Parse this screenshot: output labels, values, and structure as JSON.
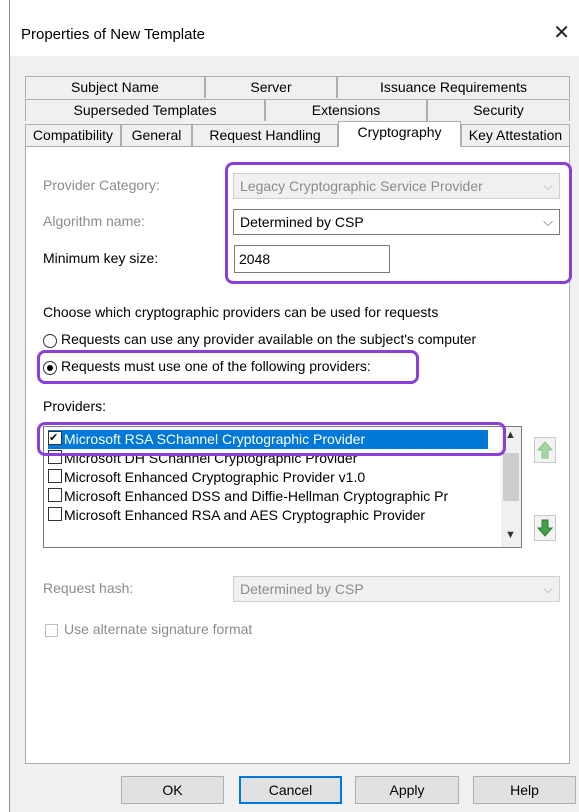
{
  "window": {
    "title": "Properties of New Template",
    "close_glyph": "✕"
  },
  "tabs": {
    "row1": [
      "Subject Name",
      "Server",
      "Issuance Requirements"
    ],
    "row2": [
      "Superseded Templates",
      "Extensions",
      "Security"
    ],
    "row3": [
      "Compatibility",
      "General",
      "Request Handling",
      "Cryptography",
      "Key Attestation"
    ],
    "active": "Cryptography"
  },
  "form": {
    "provider_category_label": "Provider Category:",
    "provider_category_value": "Legacy Cryptographic Service Provider",
    "algorithm_label": "Algorithm name:",
    "algorithm_value": "Determined by CSP",
    "min_key_label": "Minimum key size:",
    "min_key_value": "2048",
    "choose_text": "Choose which cryptographic providers can be used for requests",
    "radio_any": "Requests can use any provider available on the subject's computer",
    "radio_must": "Requests must use one of the following providers:",
    "radio_selected": "must",
    "providers_label": "Providers:",
    "providers": [
      {
        "label": "Microsoft RSA SChannel Cryptographic Provider",
        "checked": true,
        "selected": true
      },
      {
        "label": "Microsoft DH SChannel Cryptographic Provider",
        "checked": false,
        "selected": false
      },
      {
        "label": "Microsoft Enhanced Cryptographic Provider v1.0",
        "checked": false,
        "selected": false
      },
      {
        "label": "Microsoft Enhanced DSS and Diffie-Hellman Cryptographic Pr",
        "checked": false,
        "selected": false
      },
      {
        "label": "Microsoft Enhanced RSA and AES Cryptographic Provider",
        "checked": false,
        "selected": false
      }
    ],
    "request_hash_label": "Request hash:",
    "request_hash_value": "Determined by CSP",
    "alt_sig_label": "Use alternate signature format"
  },
  "buttons": {
    "ok": "OK",
    "cancel": "Cancel",
    "apply": "Apply",
    "help": "Help"
  },
  "colors": {
    "highlight": "#8b3fd9",
    "selection": "#0078d7",
    "arrow_green": "#4caf50"
  }
}
